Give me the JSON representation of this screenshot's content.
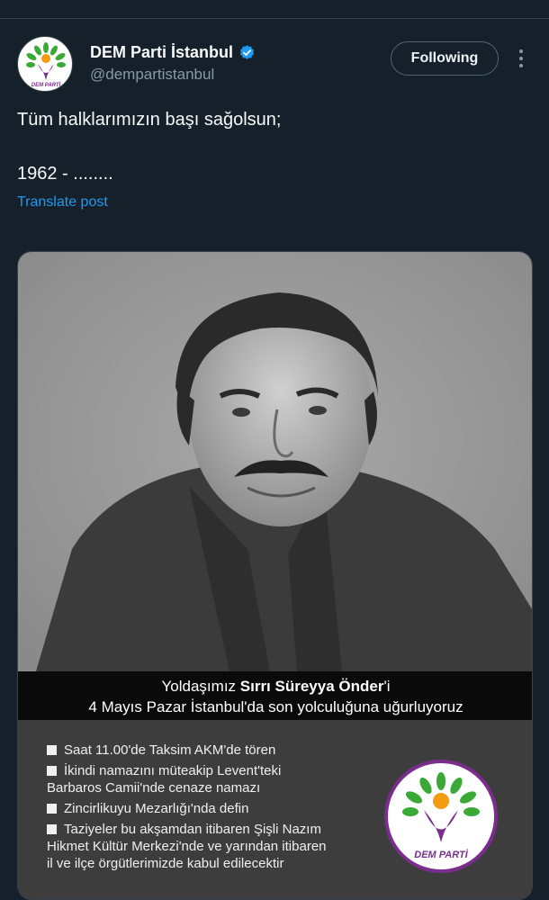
{
  "account": {
    "display_name": "DEM Parti İstanbul",
    "handle": "@dempartistanbul",
    "verified": true,
    "follow_label": "Following"
  },
  "post": {
    "line1": "Tüm halklarımızın başı sağolsun;",
    "line2": "1962 - ........",
    "translate_label": "Translate post"
  },
  "media": {
    "banner_prefix": "Yoldaşımız ",
    "banner_name": "Sırrı Süreyya Önder",
    "banner_suffix": "'i",
    "banner_line2": "4 Mayıs Pazar İstanbul'da son yolculuğuna uğurluyoruz",
    "items": [
      "Saat 11.00'de Taksim AKM'de tören",
      "İkindi namazını müteakip Levent'teki",
      "Barbaros Camii'nde cenaze namazı",
      "Zincirlikuyu Mezarlığı'nda defin",
      "Taziyeler bu akşamdan itibaren Şişli Nazım",
      "Hikmet Kültür Merkezi'nde ve yarından itibaren",
      "il ve ilçe örgütlerimizde kabul  edilecektir"
    ]
  },
  "colors": {
    "background": "#15202b",
    "link": "#1d9bf0",
    "verified": "#1d9bf0",
    "logo_green": "#3aa935",
    "logo_purple": "#7b2d8e",
    "logo_orange": "#f39c12"
  }
}
